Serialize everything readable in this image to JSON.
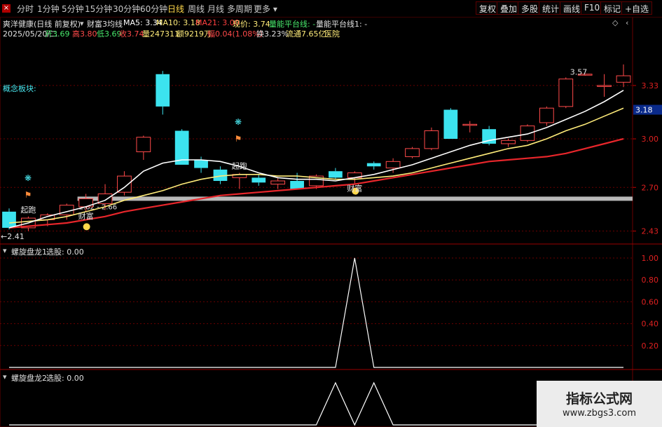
{
  "toolbar": {
    "periods": [
      "分时",
      "1分钟",
      "5分钟",
      "15分钟",
      "30分钟",
      "60分钟",
      "日线",
      "周线",
      "月线",
      "多周期",
      "更多"
    ],
    "active_period": "日线",
    "right_buttons": [
      "复权",
      "叠加",
      "多股",
      "统计",
      "画线",
      "F10",
      "标记",
      "+自选"
    ]
  },
  "header": {
    "stock_title": "爽洋健康(日线 前复权)",
    "indicator_name": "财富3均线",
    "ma5": "MA5: 3.34",
    "ma10": "MA10: 3.18",
    "ma21": "MA21: 3.00",
    "current_price": "现价: 3.74",
    "vol_platform_label": "量能平台线: -",
    "vol_platform_1": "量能平台线1: -",
    "date": "2025/05/20/二",
    "open": "开3.69",
    "high": "高3.80",
    "low": "低3.69",
    "close": "收3.74",
    "volume": "量247311",
    "amount": "额9219万",
    "change": "幅0.04(1.08%)",
    "turnover": "换3.23%",
    "float_cap": "流通7.65亿",
    "sector": "医院",
    "concept_label": "概念板块:"
  },
  "colors": {
    "up": "#ff4a4a",
    "down": "#3ce3ef",
    "ma5": "#ffffff",
    "ma10": "#ffec7a",
    "ma21": "#e8262b",
    "platform": "#b8b8b8",
    "grid": "#6a0000"
  },
  "chart_data": [
    {
      "type": "candlestick",
      "title": "财富3均线",
      "ylim": [
        2.35,
        3.62
      ],
      "yticks": [
        3.33,
        3.0,
        2.7,
        2.43
      ],
      "current_price_tag": 3.18,
      "candles": [
        {
          "o": 2.55,
          "h": 2.57,
          "l": 2.44,
          "c": 2.45
        },
        {
          "o": 2.45,
          "h": 2.52,
          "l": 2.43,
          "c": 2.51
        },
        {
          "o": 2.5,
          "h": 2.54,
          "l": 2.46,
          "c": 2.53
        },
        {
          "o": 2.53,
          "h": 2.6,
          "l": 2.5,
          "c": 2.59
        },
        {
          "o": 2.58,
          "h": 2.66,
          "l": 2.55,
          "c": 2.63
        },
        {
          "o": 2.6,
          "h": 2.72,
          "l": 2.56,
          "c": 2.66
        },
        {
          "o": 2.67,
          "h": 2.8,
          "l": 2.65,
          "c": 2.77
        },
        {
          "o": 2.92,
          "h": 3.02,
          "l": 2.87,
          "c": 3.01
        },
        {
          "o": 3.4,
          "h": 3.42,
          "l": 3.15,
          "c": 3.2
        },
        {
          "o": 3.05,
          "h": 3.06,
          "l": 2.84,
          "c": 2.84
        },
        {
          "o": 2.87,
          "h": 2.89,
          "l": 2.79,
          "c": 2.82
        },
        {
          "o": 2.81,
          "h": 2.83,
          "l": 2.72,
          "c": 2.74
        },
        {
          "o": 2.76,
          "h": 2.79,
          "l": 2.69,
          "c": 2.78
        },
        {
          "o": 2.76,
          "h": 2.78,
          "l": 2.71,
          "c": 2.73
        },
        {
          "o": 2.72,
          "h": 2.76,
          "l": 2.69,
          "c": 2.74
        },
        {
          "o": 2.74,
          "h": 2.79,
          "l": 2.7,
          "c": 2.69
        },
        {
          "o": 2.71,
          "h": 2.78,
          "l": 2.69,
          "c": 2.77
        },
        {
          "o": 2.8,
          "h": 2.82,
          "l": 2.75,
          "c": 2.76
        },
        {
          "o": 2.76,
          "h": 2.8,
          "l": 2.72,
          "c": 2.79
        },
        {
          "o": 2.85,
          "h": 2.86,
          "l": 2.81,
          "c": 2.83
        },
        {
          "o": 2.82,
          "h": 2.88,
          "l": 2.79,
          "c": 2.86
        },
        {
          "o": 2.89,
          "h": 2.95,
          "l": 2.88,
          "c": 2.94
        },
        {
          "o": 2.94,
          "h": 3.07,
          "l": 2.93,
          "c": 3.05
        },
        {
          "o": 3.18,
          "h": 3.19,
          "l": 3.0,
          "c": 3.0
        },
        {
          "o": 3.09,
          "h": 3.11,
          "l": 3.04,
          "c": 3.09
        },
        {
          "o": 3.06,
          "h": 3.08,
          "l": 2.96,
          "c": 2.97
        },
        {
          "o": 2.97,
          "h": 3.0,
          "l": 2.95,
          "c": 2.99
        },
        {
          "o": 2.99,
          "h": 3.09,
          "l": 2.98,
          "c": 3.08
        },
        {
          "o": 3.1,
          "h": 3.2,
          "l": 3.08,
          "c": 3.19
        },
        {
          "o": 3.2,
          "h": 3.38,
          "l": 3.19,
          "c": 3.37
        },
        {
          "o": 3.4,
          "h": 3.4,
          "l": 3.39,
          "c": 3.4
        },
        {
          "o": 3.33,
          "h": 3.4,
          "l": 3.26,
          "c": 3.33
        },
        {
          "o": 3.35,
          "h": 3.46,
          "l": 3.32,
          "c": 3.39
        }
      ],
      "ma5": [
        2.45,
        2.48,
        2.52,
        2.55,
        2.58,
        2.62,
        2.7,
        2.8,
        2.85,
        2.87,
        2.87,
        2.86,
        2.83,
        2.79,
        2.76,
        2.75,
        2.75,
        2.74,
        2.76,
        2.78,
        2.81,
        2.84,
        2.88,
        2.92,
        2.96,
        2.99,
        3.01,
        3.03,
        3.07,
        3.12,
        3.17,
        3.23,
        3.3
      ],
      "ma10": [
        2.48,
        2.49,
        2.5,
        2.52,
        2.55,
        2.58,
        2.62,
        2.65,
        2.68,
        2.72,
        2.75,
        2.77,
        2.78,
        2.78,
        2.77,
        2.77,
        2.76,
        2.75,
        2.75,
        2.76,
        2.77,
        2.79,
        2.82,
        2.85,
        2.88,
        2.91,
        2.94,
        2.96,
        3.0,
        3.05,
        3.09,
        3.14,
        3.19
      ],
      "ma21": [
        2.45,
        2.46,
        2.47,
        2.48,
        2.5,
        2.52,
        2.55,
        2.57,
        2.59,
        2.61,
        2.63,
        2.65,
        2.66,
        2.67,
        2.68,
        2.69,
        2.7,
        2.71,
        2.72,
        2.74,
        2.76,
        2.78,
        2.8,
        2.82,
        2.84,
        2.86,
        2.87,
        2.88,
        2.89,
        2.91,
        2.94,
        2.97,
        3.0
      ],
      "platform": {
        "value": 2.63,
        "label": "2.62 - 2.66"
      },
      "annotations": [
        {
          "text": "3.57",
          "at": 29
        },
        {
          "text": "←2.41",
          "at": 0
        },
        {
          "text": "财富",
          "at": 4
        },
        {
          "text": "财富",
          "at": 18
        },
        {
          "text": "起跑",
          "at": 1
        },
        {
          "text": "起跑",
          "at": 12
        }
      ]
    },
    {
      "type": "line",
      "title": "螺旋盘龙1",
      "legend": "选股: 0.00",
      "ylim": [
        0,
        1
      ],
      "yticks": [
        1.0,
        0.8,
        0.6,
        0.4,
        0.2,
        0.0
      ],
      "values": [
        0,
        0,
        0,
        0,
        0,
        0,
        0,
        0,
        0,
        0,
        0,
        0,
        0,
        0,
        0,
        0,
        0,
        0,
        1,
        0,
        0,
        0,
        0,
        0,
        0,
        0,
        0,
        0,
        0,
        0,
        0,
        0,
        0
      ]
    },
    {
      "type": "line",
      "title": "螺旋盘龙2",
      "legend": "选股: 0.00",
      "ylim": [
        0,
        1
      ],
      "values": [
        0,
        0,
        0,
        0,
        0,
        0,
        0,
        0,
        0,
        0,
        0,
        0,
        0,
        0,
        0,
        0,
        0,
        1,
        0,
        1,
        0,
        0,
        0,
        0,
        0,
        0,
        0,
        0,
        0,
        0,
        0,
        0,
        0
      ]
    }
  ],
  "watermark": {
    "title": "指标公式网",
    "url": "www.zbgs3.com"
  }
}
